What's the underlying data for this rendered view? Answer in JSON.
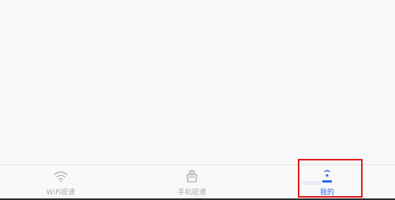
{
  "tabbar": {
    "tabs": [
      {
        "label": "WiFi提速",
        "icon": "wifi-icon",
        "active": false
      },
      {
        "label": "手机提速",
        "icon": "shopping-basket-icon",
        "active": false
      },
      {
        "label": "我的",
        "icon": "user-profile-icon",
        "active": true
      }
    ]
  },
  "colors": {
    "active": "#2c6fe0",
    "inactive": "#a9abb0",
    "highlight": "#e11d1d"
  }
}
